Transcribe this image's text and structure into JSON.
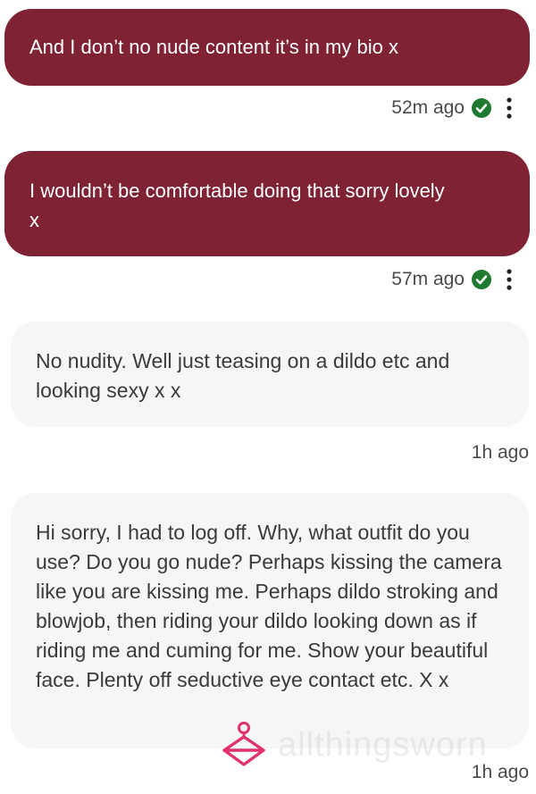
{
  "messages": [
    {
      "direction": "sent",
      "text": "And I don’t no nude content it’s in my bio x",
      "time": "52m ago",
      "status_icon": "check-circle-icon",
      "menu_icon": "kebab-menu-icon"
    },
    {
      "direction": "sent",
      "text": "I wouldn’t be comfortable doing that sorry lovely x",
      "time": "57m ago",
      "status_icon": "check-circle-icon",
      "menu_icon": "kebab-menu-icon"
    },
    {
      "direction": "received",
      "text": "No nudity. Well just teasing on a dildo etc and looking sexy x x",
      "time": "1h ago"
    },
    {
      "direction": "received",
      "text": "Hi sorry, I had to log off. Why, what outfit do you use? Do you go nude? Perhaps kissing the camera like you are kissing me. Perhaps dildo stroking and blowjob, then riding your dildo looking down as if riding me and cuming for me. Show your beautiful face. Plenty off seductive eye contact etc. X x",
      "time": "1h ago"
    }
  ],
  "colors": {
    "sent_bubble": "#7e2234",
    "received_bubble": "#f5f6f7",
    "check_green": "#1e7a2e",
    "watermark_pink": "#e0336b"
  },
  "watermark": {
    "icon": "hanger-icon",
    "text": "allthingsworn"
  }
}
